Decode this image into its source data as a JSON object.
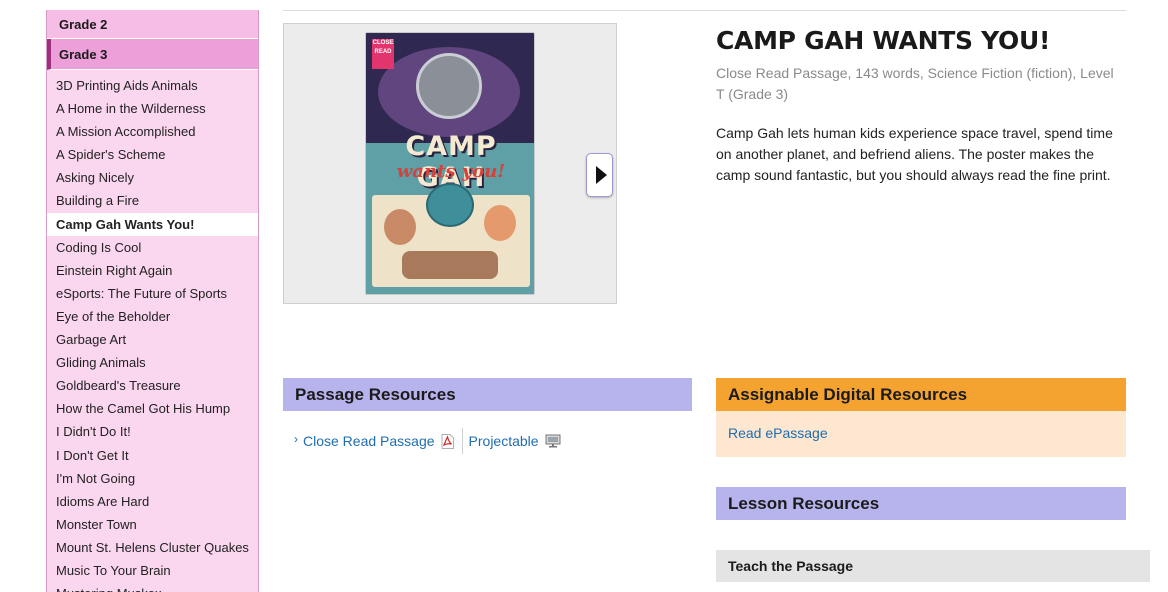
{
  "sidebar": {
    "grade2_label": "Grade 2",
    "grade3_label": "Grade 3",
    "items": [
      "3D Printing Aids Animals",
      "A Home in the Wilderness",
      "A Mission Accomplished",
      "A Spider's Scheme",
      "Asking Nicely",
      "Building a Fire",
      "Camp Gah Wants You!",
      "Coding Is Cool",
      "Einstein Right Again",
      "eSports: The Future of Sports",
      "Eye of the Beholder",
      "Garbage Art",
      "Gliding Animals",
      "Goldbeard's Treasure",
      "How the Camel Got His Hump",
      "I Didn't Do It!",
      "I Don't Get It",
      "I'm Not Going",
      "Idioms Are Hard",
      "Monster Town",
      "Mount St. Helens Cluster Quakes",
      "Music To Your Brain",
      "Mustering Muskox"
    ],
    "active_item": "Camp Gah Wants You!"
  },
  "poster": {
    "badge": "CLOSE READ",
    "title": "CAMP GAH",
    "subtitle": "wants you!"
  },
  "passage": {
    "title": "CAMP GAH WANTS YOU!",
    "meta": "Close Read Passage, 143 words, Science Fiction (fiction), Level T (Grade 3)",
    "description": "Camp Gah lets human kids experience space travel, spend time on another planet, and befriend aliens. The poster makes the camp sound fantastic, but you should always read the fine print."
  },
  "passage_resources": {
    "header": "Passage Resources",
    "close_read_link": "Close Read Passage",
    "projectable_link": "Projectable"
  },
  "assignable": {
    "header": "Assignable Digital Resources",
    "read_epassage_link": "Read ePassage"
  },
  "lesson_resources": {
    "header": "Lesson Resources",
    "teach_label": "Teach the Passage"
  },
  "colors": {
    "sidebar_bg": "#fbd6ef",
    "grade_active": "#ec9fd8",
    "lavender_header": "#b7b3ec",
    "orange_header": "#f4a230",
    "link": "#1f6db0"
  },
  "icons": {
    "next": "play-triangle-icon",
    "pdf": "pdf-icon",
    "projector": "monitor-icon",
    "chevron": "chevron-right-icon"
  }
}
